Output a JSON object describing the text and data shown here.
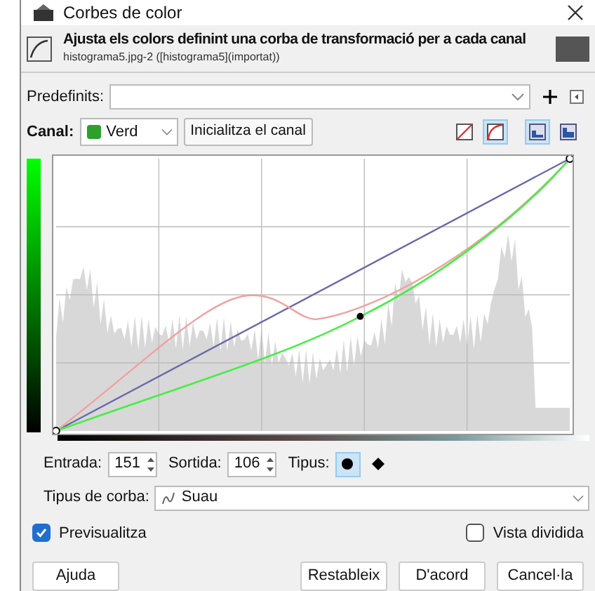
{
  "window": {
    "title": "Corbes de color"
  },
  "header": {
    "title": "Ajusta els colors definint una corba de transformació per a cada canal",
    "subtitle": "histograma5.jpg-2 ([histograma5](importat))"
  },
  "presets": {
    "label": "Predefinits:"
  },
  "channel": {
    "label": "Canal:",
    "value": "Verd",
    "reset_button": "Inicialitza el canal"
  },
  "scale_buttons": [
    {
      "kind": "linear",
      "selected": false
    },
    {
      "kind": "log",
      "selected": true
    }
  ],
  "histogram_buttons": [
    {
      "kind": "linear",
      "selected": true
    },
    {
      "kind": "log",
      "selected": false
    }
  ],
  "point": {
    "input_label": "Entrada:",
    "input": "151",
    "output_label": "Sortida:",
    "output": "106",
    "type_label": "Tipus:",
    "types": [
      {
        "kind": "smooth",
        "selected": true
      },
      {
        "kind": "corner",
        "selected": false
      }
    ]
  },
  "curve_type": {
    "label": "Tipus de corba:",
    "value": "Suau"
  },
  "preview": {
    "label": "Previsualitza",
    "checked": true
  },
  "split_view": {
    "label": "Vista dividida",
    "checked": false
  },
  "buttons": [
    "Ajuda",
    "Restableix",
    "D'acord",
    "Cancel·la"
  ]
}
